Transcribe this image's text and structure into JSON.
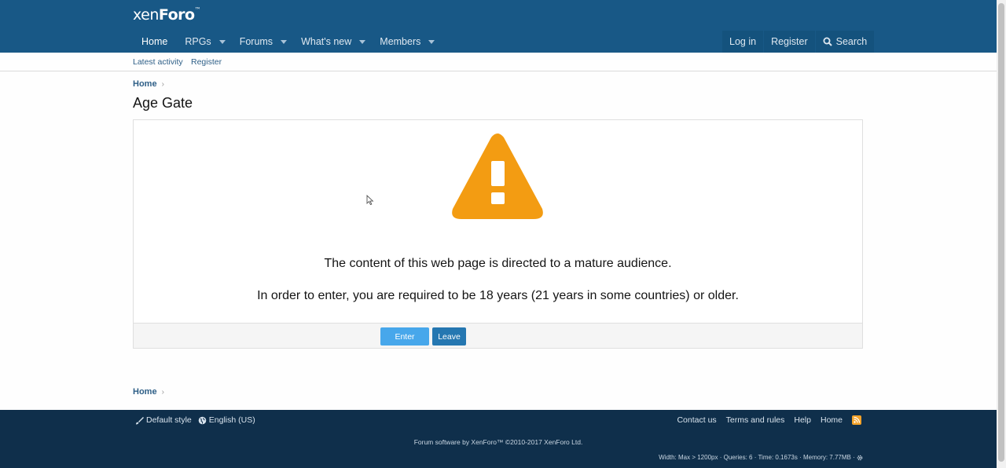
{
  "header": {
    "logo_text_a": "xen",
    "logo_text_b": "Foro",
    "nav": [
      {
        "label": "Home",
        "has_menu": false
      },
      {
        "label": "RPGs",
        "has_menu": true
      },
      {
        "label": "Forums",
        "has_menu": true
      },
      {
        "label": "What's new",
        "has_menu": true
      },
      {
        "label": "Members",
        "has_menu": true
      }
    ],
    "login_label": "Log in",
    "register_label": "Register",
    "search_label": "Search"
  },
  "subnav": {
    "latest_activity": "Latest activity",
    "register": "Register"
  },
  "breadcrumb_top": "Home",
  "page_title": "Age Gate",
  "age_gate": {
    "message1": "The content of this web page is directed to a mature audience.",
    "message2": "In order to enter, you are required to be 18 years (21 years in some countries) or older.",
    "enter_label": "Enter",
    "leave_label": "Leave",
    "warning_color": "#f39c12"
  },
  "breadcrumb_bottom": "Home",
  "footer": {
    "style_label": "Default style",
    "language_label": "English (US)",
    "links": [
      "Contact us",
      "Terms and rules",
      "Help",
      "Home"
    ],
    "copyright": "Forum software by XenForo™ ©2010-2017 XenForo Ltd.",
    "debug": "Width: Max > 1200px · Queries: 6 · Time: 0.1673s · Memory: 7.77MB ·"
  }
}
